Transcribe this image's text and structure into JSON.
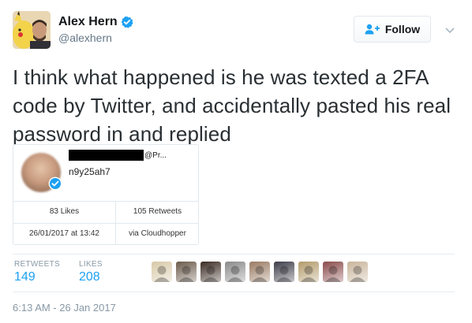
{
  "author": {
    "name": "Alex Hern",
    "handle": "@alexhern"
  },
  "follow_button": {
    "label": "Follow"
  },
  "tweet": {
    "text": "I think what happened is he was texted a 2FA code by Twitter, and accidentally pasted his real password in and replied"
  },
  "embedded_tweet": {
    "handle": "@Pr...",
    "text": "n9y25ah7",
    "likes": "83 Likes",
    "retweets": "105 Retweets",
    "datetime": "26/01/2017 at 13:42",
    "source": "via Cloudhopper"
  },
  "stats": {
    "retweets_label": "RETWEETS",
    "retweets_count": "149",
    "likes_label": "LIKES",
    "likes_count": "208"
  },
  "likers": [
    {
      "icon": "liker-avatar-1",
      "color": "#d8c9a8"
    },
    {
      "icon": "liker-avatar-2",
      "color": "#6b5a4a"
    },
    {
      "icon": "liker-avatar-3",
      "color": "#3a2a22"
    },
    {
      "icon": "liker-avatar-4",
      "color": "#8a8a8a"
    },
    {
      "icon": "liker-avatar-5",
      "color": "#9a7a62"
    },
    {
      "icon": "liker-avatar-6",
      "color": "#3c3c48"
    },
    {
      "icon": "liker-avatar-7",
      "color": "#b29a6a"
    },
    {
      "icon": "liker-avatar-8",
      "color": "#8a4a4a"
    },
    {
      "icon": "liker-avatar-9",
      "color": "#c8b49a"
    }
  ],
  "timestamp": "6:13 AM - 26 Jan 2017",
  "colors": {
    "accent": "#1da1f2",
    "text": "#292f33",
    "muted": "#8899a6"
  }
}
